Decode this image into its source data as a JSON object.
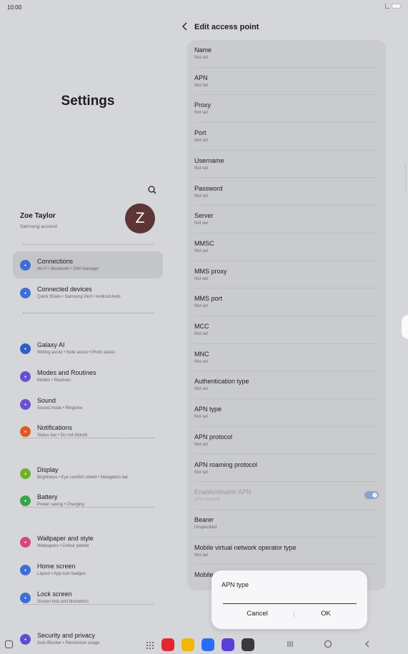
{
  "status_bar": {
    "time": "10:00"
  },
  "settings_title": "Settings",
  "profile": {
    "name": "Zoe Taylor",
    "subtitle": "Samsung account",
    "avatar_initial": "Z"
  },
  "menu": [
    {
      "title": "Connections",
      "sub": "Wi-Fi  •  Bluetooth  •  SIM manager",
      "color": "#3a6fd8",
      "icon": "wifi-icon"
    },
    {
      "title": "Connected devices",
      "sub": "Quick Share  •  Samsung DeX  •  Android Auto",
      "color": "#3a6fd8",
      "icon": "devices-icon"
    },
    {
      "title": "Galaxy AI",
      "sub": "Writing assist  •  Note assist  •  Photo assist",
      "color": "#2e5ec7",
      "icon": "sparkle-icon"
    },
    {
      "title": "Modes and Routines",
      "sub": "Modes  •  Routines",
      "color": "#6c4fcf",
      "icon": "check-circle-icon"
    },
    {
      "title": "Sound",
      "sub": "Sound mode  •  Ringtone",
      "color": "#6c4fcf",
      "icon": "speaker-icon"
    },
    {
      "title": "Notifications",
      "sub": "Status bar  •  Do not disturb",
      "color": "#e15a22",
      "icon": "bell-icon"
    },
    {
      "title": "Display",
      "sub": "Brightness  •  Eye comfort shield  •  Navigation bar",
      "color": "#6fb12e",
      "icon": "sun-icon"
    },
    {
      "title": "Battery",
      "sub": "Power saving  •  Charging",
      "color": "#3aa34a",
      "icon": "battery-icon"
    },
    {
      "title": "Wallpaper and style",
      "sub": "Wallpapers  •  Colour palette",
      "color": "#d9457a",
      "icon": "image-icon"
    },
    {
      "title": "Home screen",
      "sub": "Layout  •  App icon badges",
      "color": "#3a6fd8",
      "icon": "home-icon"
    },
    {
      "title": "Lock screen",
      "sub": "Screen lock and biometrics",
      "color": "#3a6fd8",
      "icon": "lock-icon"
    },
    {
      "title": "Security and privacy",
      "sub": "Auto Blocker  •  Permission usage",
      "color": "#5a4fcf",
      "icon": "shield-icon"
    }
  ],
  "edit_ap": {
    "title": "Edit access point",
    "rows": [
      {
        "title": "Name",
        "sub": "Not set"
      },
      {
        "title": "APN",
        "sub": "Not set"
      },
      {
        "title": "Proxy",
        "sub": "Not set"
      },
      {
        "title": "Port",
        "sub": "Not set"
      },
      {
        "title": "Username",
        "sub": "Not set"
      },
      {
        "title": "Password",
        "sub": "Not set"
      },
      {
        "title": "Server",
        "sub": "Not set"
      },
      {
        "title": "MMSC",
        "sub": "Not set"
      },
      {
        "title": "MMS proxy",
        "sub": "Not set"
      },
      {
        "title": "MMS port",
        "sub": "Not set"
      },
      {
        "title": "MCC",
        "sub": "Not set"
      },
      {
        "title": "MNC",
        "sub": "Not set"
      },
      {
        "title": "Authentication type",
        "sub": "Not set"
      },
      {
        "title": "APN type",
        "sub": "Not set"
      },
      {
        "title": "APN protocol",
        "sub": "Not set"
      },
      {
        "title": "APN roaming protocol",
        "sub": "Not set"
      },
      {
        "title": "Enable/disable APN",
        "sub": "APN enabled",
        "disabled": true,
        "toggle": true
      },
      {
        "title": "Bearer",
        "sub": "Unspecified"
      },
      {
        "title": "Mobile virtual network operator type",
        "sub": "Not set"
      },
      {
        "title": "Mobile",
        "sub": ""
      }
    ]
  },
  "dialog": {
    "title": "APN type",
    "input_value": "",
    "cancel": "Cancel",
    "ok": "OK"
  },
  "dock": [
    {
      "name": "notes-app-icon",
      "color": "#e0282e"
    },
    {
      "name": "files-app-icon",
      "color": "#f2b705"
    },
    {
      "name": "messages-app-icon",
      "color": "#2a6df4"
    },
    {
      "name": "internet-app-icon",
      "color": "#5b3fd6"
    },
    {
      "name": "camera-app-icon",
      "color": "#3a3a3c"
    }
  ]
}
